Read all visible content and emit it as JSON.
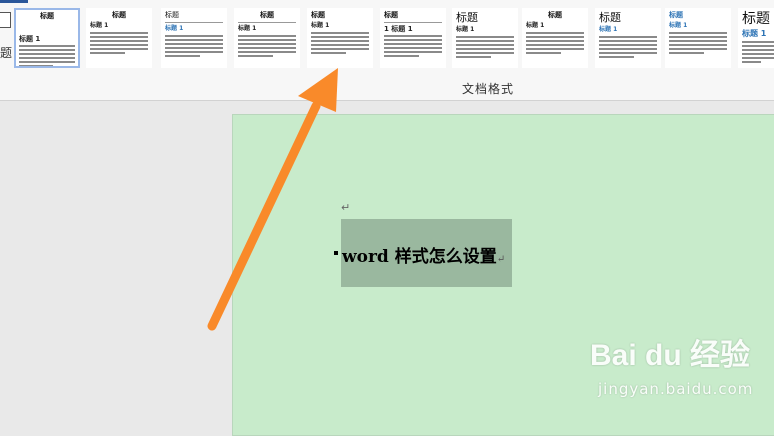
{
  "ribbon": {
    "left_button_label": "题",
    "group_label": "文档格式",
    "styles": [
      {
        "title": "标题",
        "heading": "标题 1",
        "variant": "default",
        "selected": true
      },
      {
        "title": "标题",
        "heading": "标题 1",
        "variant": "bold-center",
        "selected": false
      },
      {
        "title": "标题",
        "heading": "标题 1",
        "variant": "serif-rule",
        "selected": false
      },
      {
        "title": "标题",
        "heading": "标题 1",
        "variant": "center-rule",
        "selected": false
      },
      {
        "title": "标题",
        "heading": "标题 1",
        "variant": "bold-left",
        "selected": false
      },
      {
        "title": "标题",
        "heading": "1 标题 1",
        "variant": "numbered",
        "selected": false
      },
      {
        "title": "标题",
        "heading": "标题 1",
        "variant": "large",
        "selected": false
      },
      {
        "title": "标题",
        "heading": "标题 1",
        "variant": "bold-center-small",
        "selected": false
      },
      {
        "title": "标题",
        "heading": "标题 1",
        "variant": "serif-large",
        "selected": false
      },
      {
        "title": "标题",
        "heading": "标题 1",
        "variant": "blue",
        "selected": false
      },
      {
        "title": "标题",
        "heading": "标题 1",
        "variant": "xl",
        "selected": false
      }
    ]
  },
  "document": {
    "heading_text": "word 样式怎么设置",
    "paragraph_mark": "↵",
    "background_color": "#c8ebcb",
    "selection_color": "#9ab89f"
  },
  "annotation": {
    "arrow_color": "#f98a2a"
  },
  "watermark": {
    "logo": "Bai du 经验",
    "url": "jingyan.baidu.com"
  }
}
